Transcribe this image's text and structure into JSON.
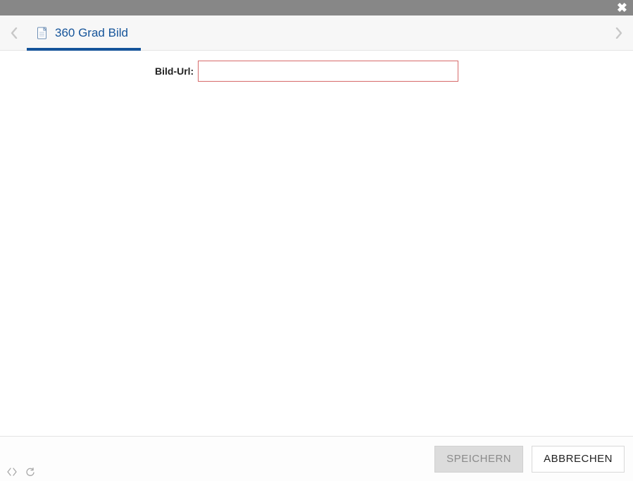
{
  "titlebar": {},
  "tabs": {
    "active": {
      "label": "360 Grad Bild",
      "icon": "document-icon"
    }
  },
  "form": {
    "bild_url": {
      "label": "Bild-Url:",
      "value": "",
      "placeholder": ""
    }
  },
  "footer": {
    "save_label": "SPEICHERN",
    "cancel_label": "ABBRECHEN"
  },
  "colors": {
    "accent": "#15549a",
    "error_border": "#d66a6a",
    "titlebar": "#878787"
  }
}
